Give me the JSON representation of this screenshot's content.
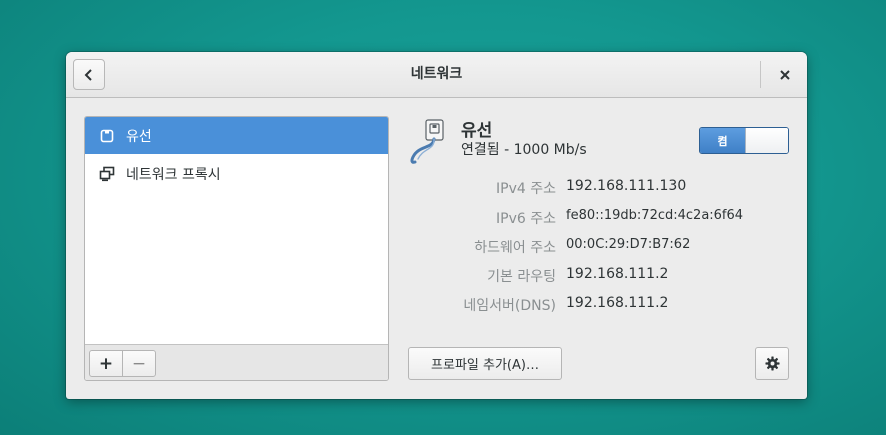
{
  "header": {
    "title": "네트워크",
    "back_icon": "go-previous-icon",
    "close_icon": "close-icon"
  },
  "sidebar": {
    "items": [
      {
        "label": "유선",
        "icon": "wired-network-icon",
        "selected": true
      },
      {
        "label": "네트워크 프록시",
        "icon": "network-proxy-icon",
        "selected": false
      }
    ],
    "add_label": "+",
    "remove_label": "−"
  },
  "device": {
    "name": "유선",
    "status": "연결됨 - 1000 Mb/s",
    "icon": "wired-cable-icon",
    "switch_label": "켬",
    "switch_on": true
  },
  "details": [
    {
      "label": "IPv4 주소",
      "value": "192.168.111.130"
    },
    {
      "label": "IPv6 주소",
      "value": "fe80::19db:72cd:4c2a:6f64"
    },
    {
      "label": "하드웨어 주소",
      "value": "00:0C:29:D7:B7:62"
    },
    {
      "label": "기본 라우팅",
      "value": "192.168.111.2"
    },
    {
      "label": "네임서버(DNS)",
      "value": "192.168.111.2"
    }
  ],
  "actions": {
    "add_profile_label": "프로파일 추가(A)…",
    "settings_icon": "gear-icon"
  },
  "colors": {
    "accent": "#4a90d9",
    "desktop": "#13978f"
  }
}
